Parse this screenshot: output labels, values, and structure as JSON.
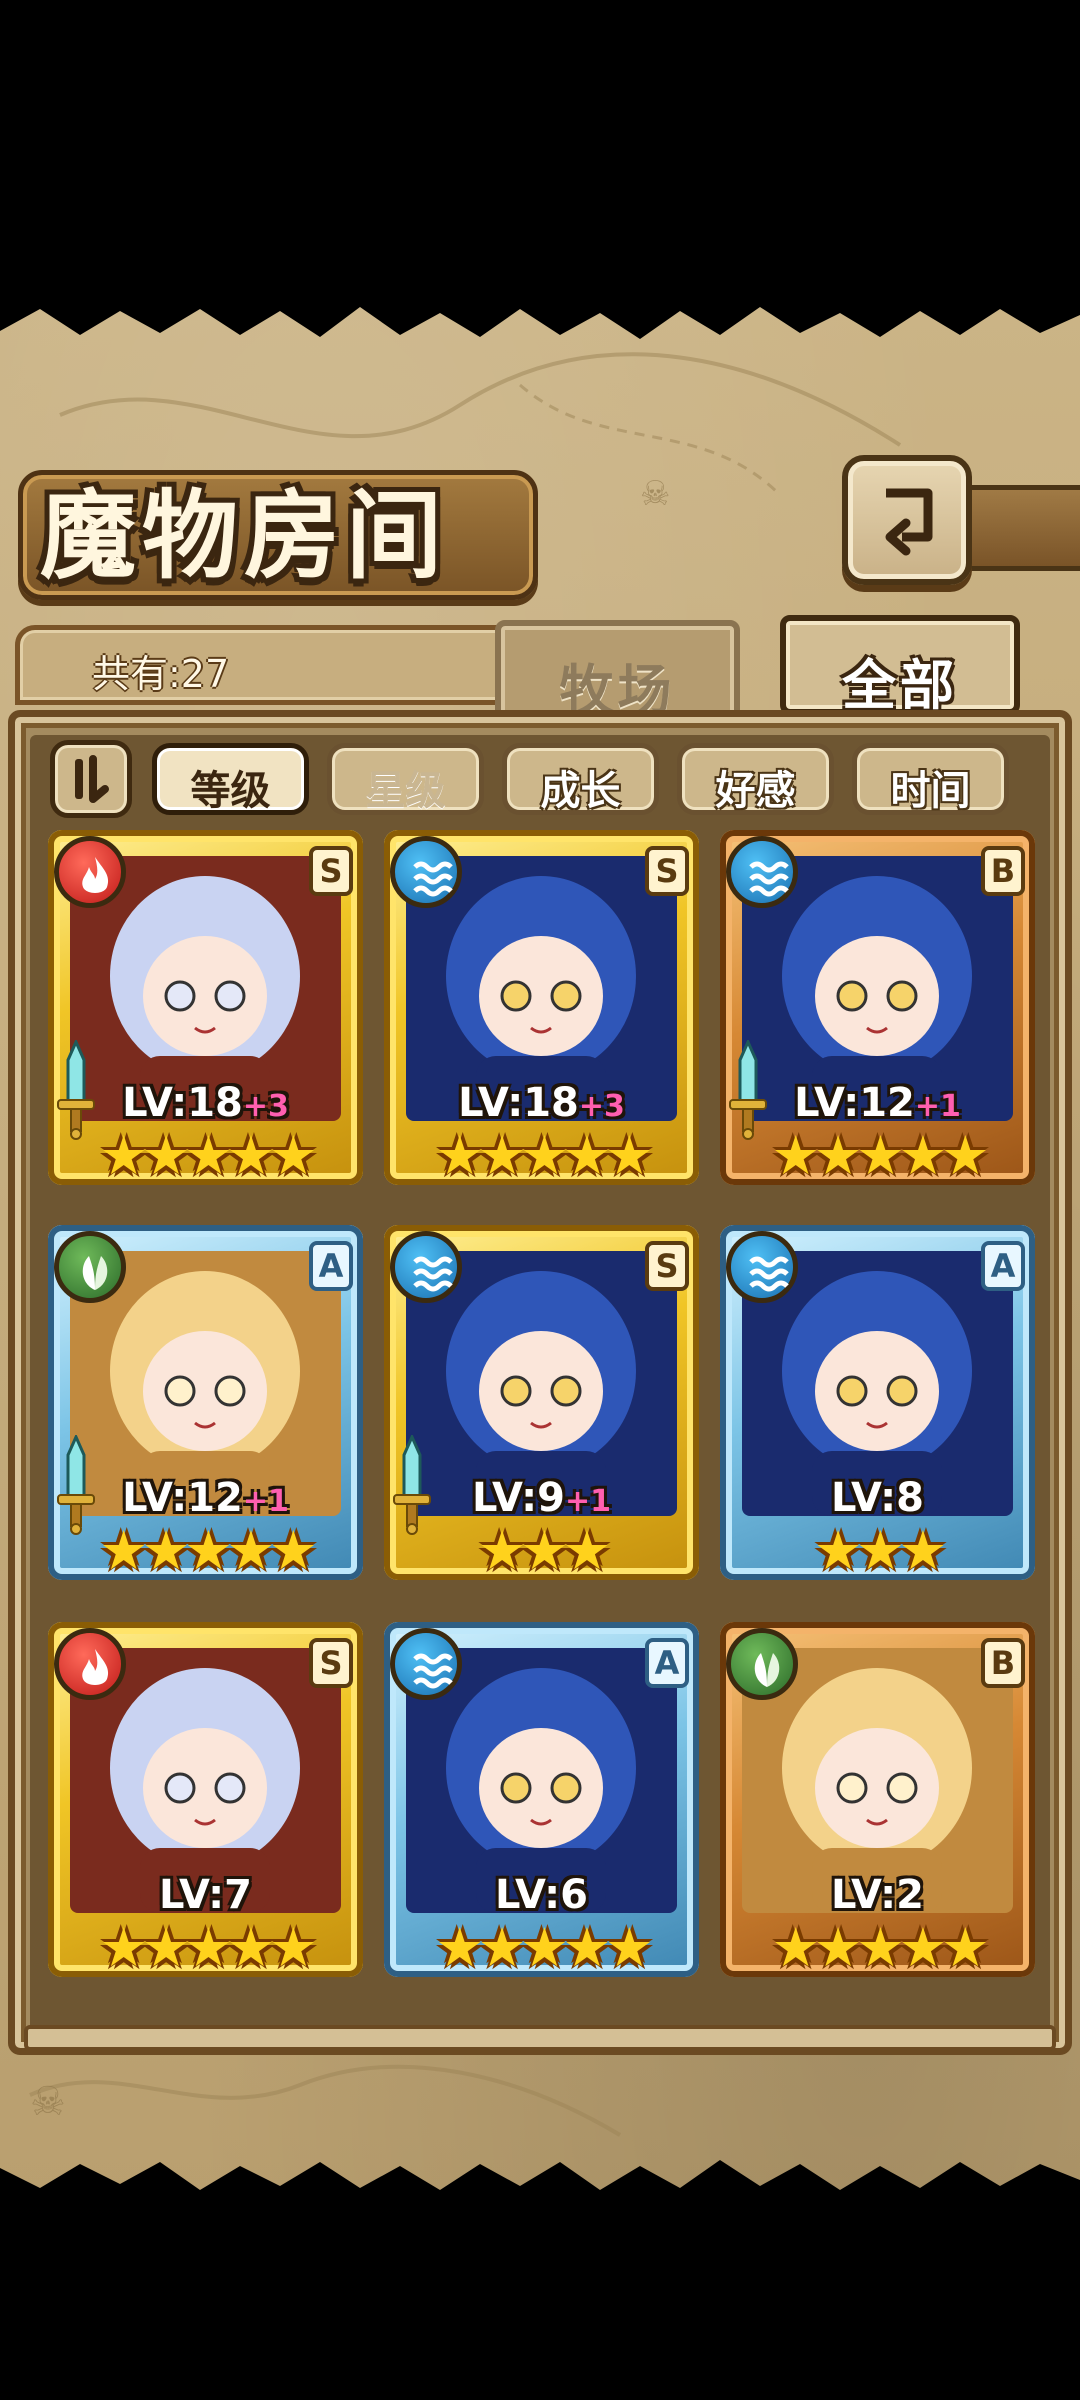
{
  "header": {
    "title": "魔物房间",
    "count_label": "共有:27",
    "tabs": [
      {
        "label": "牧场",
        "active": false
      },
      {
        "label": "全部",
        "active": true
      }
    ]
  },
  "sort": {
    "options": [
      {
        "label": "等级",
        "state": "active"
      },
      {
        "label": "星级",
        "state": "dim"
      },
      {
        "label": "成长",
        "state": "normal"
      },
      {
        "label": "好感",
        "state": "normal"
      },
      {
        "label": "时间",
        "state": "normal"
      }
    ]
  },
  "monsters": [
    {
      "element": "fire",
      "grade": "S",
      "frame": "gold",
      "level": "LV:18",
      "bonus": "+3",
      "stars": 5,
      "equipped": true
    },
    {
      "element": "water",
      "grade": "S",
      "frame": "gold",
      "level": "LV:18",
      "bonus": "+3",
      "stars": 5,
      "equipped": false
    },
    {
      "element": "water",
      "grade": "B",
      "frame": "bronze",
      "level": "LV:12",
      "bonus": "+1",
      "stars": 5,
      "equipped": true
    },
    {
      "element": "wood",
      "grade": "A",
      "frame": "blue",
      "level": "LV:12",
      "bonus": "+1",
      "stars": 5,
      "equipped": true
    },
    {
      "element": "water",
      "grade": "S",
      "frame": "gold",
      "level": "LV:9",
      "bonus": "+1",
      "stars": 3,
      "equipped": true
    },
    {
      "element": "water",
      "grade": "A",
      "frame": "blue",
      "level": "LV:8",
      "bonus": "",
      "stars": 3,
      "equipped": false
    },
    {
      "element": "fire",
      "grade": "S",
      "frame": "gold",
      "level": "LV:7",
      "bonus": "",
      "stars": 5,
      "equipped": false
    },
    {
      "element": "water",
      "grade": "A",
      "frame": "blue",
      "level": "LV:6",
      "bonus": "",
      "stars": 5,
      "equipped": false
    },
    {
      "element": "wood",
      "grade": "B",
      "frame": "bronze",
      "level": "LV:2",
      "bonus": "",
      "stars": 5,
      "equipped": false
    }
  ],
  "colors": {
    "parchment": "#c4ab7b",
    "frame_brown": "#6b4a22",
    "gold_frame": "#f0c526",
    "blue_frame": "#7cc4e6",
    "bronze_frame": "#d68834",
    "level_bonus": "#ff5fb0"
  }
}
